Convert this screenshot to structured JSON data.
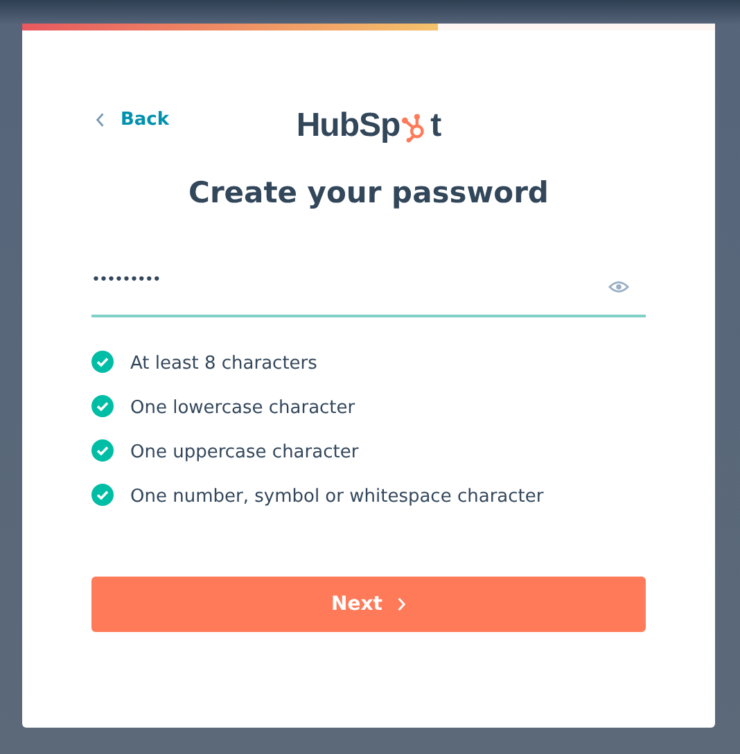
{
  "progress": {
    "level": 0.6
  },
  "back_link": {
    "label": "Back"
  },
  "logo": {
    "before": "HubSp",
    "after": "t"
  },
  "title": "Create your password",
  "password_field": {
    "value": "•••••••••",
    "focused": true
  },
  "requirements": [
    {
      "label": "At least 8 characters",
      "met": true
    },
    {
      "label": "One lowercase character",
      "met": true
    },
    {
      "label": "One uppercase character",
      "met": true
    },
    {
      "label": "One number, symbol or whitespace character",
      "met": true
    }
  ],
  "next_button": {
    "label": "Next",
    "disabled": false
  }
}
